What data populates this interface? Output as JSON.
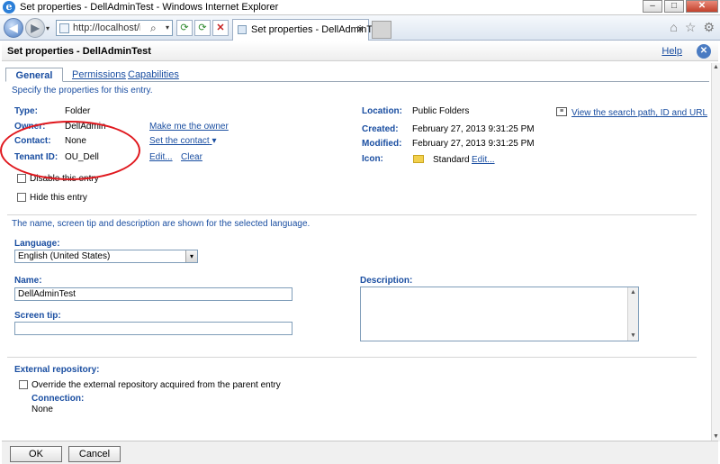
{
  "window": {
    "title": "Set properties - DellAdminTest - Windows Internet Explorer",
    "ie_logo_letter": "e",
    "minimize": "–",
    "maximize": "□",
    "close": "✕"
  },
  "browser": {
    "url": "http://localhost/ibmcog",
    "tab_label": "Set properties - DellAdminTest",
    "tab_close": "✕",
    "back": "◀",
    "forward": "▶",
    "refresh": "⟳",
    "stop": "✕",
    "search_icon": "⌕",
    "dropdown": "▾",
    "home_icon": "⌂",
    "favorites_icon": "☆",
    "tools_icon": "⚙"
  },
  "dialog": {
    "title": "Set properties - DellAdminTest",
    "help": "Help",
    "close": "✕"
  },
  "tabs": {
    "general": "General",
    "permissions": "Permissions",
    "capabilities": "Capabilities"
  },
  "hint": "Specify the properties for this entry.",
  "fields": {
    "type_label": "Type:",
    "type_value": "Folder",
    "owner_label": "Owner:",
    "owner_value": "DellAdmin",
    "make_owner": "Make me the owner",
    "contact_label": "Contact:",
    "contact_value": "None",
    "set_contact": "Set the contact",
    "tenant_label": "Tenant ID:",
    "tenant_value": "OU_Dell",
    "tenant_edit": "Edit...",
    "tenant_clear": "Clear",
    "location_label": "Location:",
    "location_value": "Public Folders",
    "view_search_path": "View the search path, ID and URL",
    "created_label": "Created:",
    "created_value": "February 27, 2013 9:31:25 PM",
    "modified_label": "Modified:",
    "modified_value": "February 27, 2013 9:31:25 PM",
    "icon_label": "Icon:",
    "icon_value": "Standard",
    "icon_edit": "Edit..."
  },
  "checkboxes": {
    "disable": "Disable this entry",
    "hide": "Hide this entry"
  },
  "language_section": {
    "note": "The name, screen tip and description are shown for the selected language.",
    "language_label": "Language:",
    "language_value": "English (United States)",
    "name_label": "Name:",
    "name_value": "DellAdminTest",
    "screentip_label": "Screen tip:",
    "screentip_value": "",
    "description_label": "Description:"
  },
  "external": {
    "label": "External repository:",
    "override": "Override the external repository acquired from the parent entry",
    "connection_label": "Connection:",
    "connection_value": "None"
  },
  "footer": {
    "ok": "OK",
    "cancel": "Cancel"
  },
  "colors": {
    "link_blue": "#1a4ea1",
    "annotation_red": "#e0181e"
  }
}
